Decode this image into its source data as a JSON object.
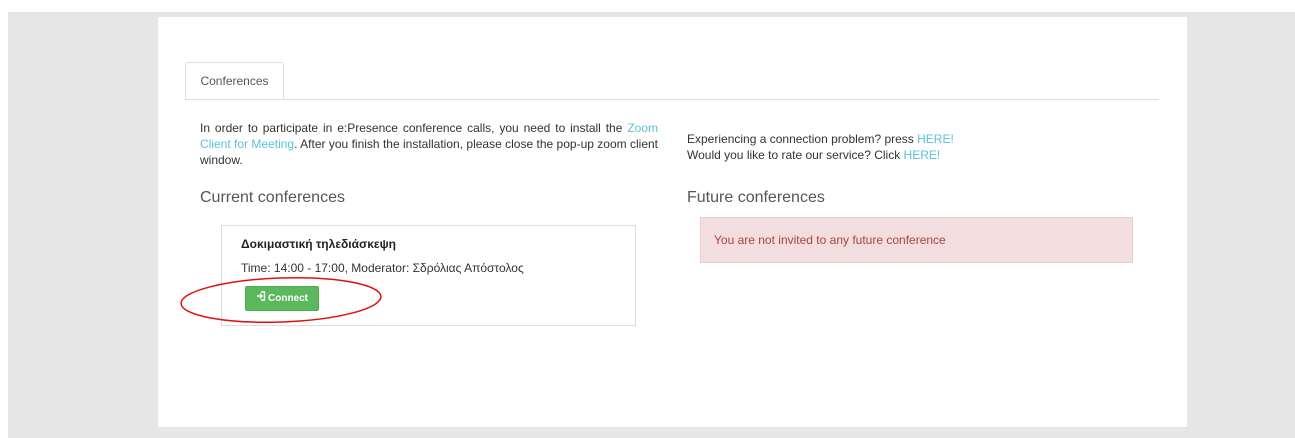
{
  "tabs": {
    "conferences": "Conferences"
  },
  "intro": {
    "text_before": "In order to participate in e:Presence conference calls, you need to install the ",
    "link": "Zoom Client for Meeting",
    "text_after": ". After you finish the installation, please close the pop-up zoom client window."
  },
  "support": {
    "line1_text": "Experiencing a connection problem? press ",
    "line1_link": "HERE!",
    "line2_text": "Would you like to rate our service? Click ",
    "line2_link": "HERE!"
  },
  "current": {
    "heading": "Current conferences",
    "conference": {
      "title": "Δοκιμαστική τηλεδιάσκεψη",
      "meta": "Time: 14:00 - 17:00, Moderator: Σδρόλιας Απόστολος",
      "connect_label": "Connect",
      "connect_icon": "sign-in-icon"
    }
  },
  "future": {
    "heading": "Future conferences",
    "alert": "You are not invited to any future conference"
  },
  "colors": {
    "accent_link": "#5bc0de",
    "connect_button": "#5cb85c",
    "alert_bg": "#f2dede",
    "alert_text": "#a94442",
    "annotation_red": "#e01010"
  }
}
